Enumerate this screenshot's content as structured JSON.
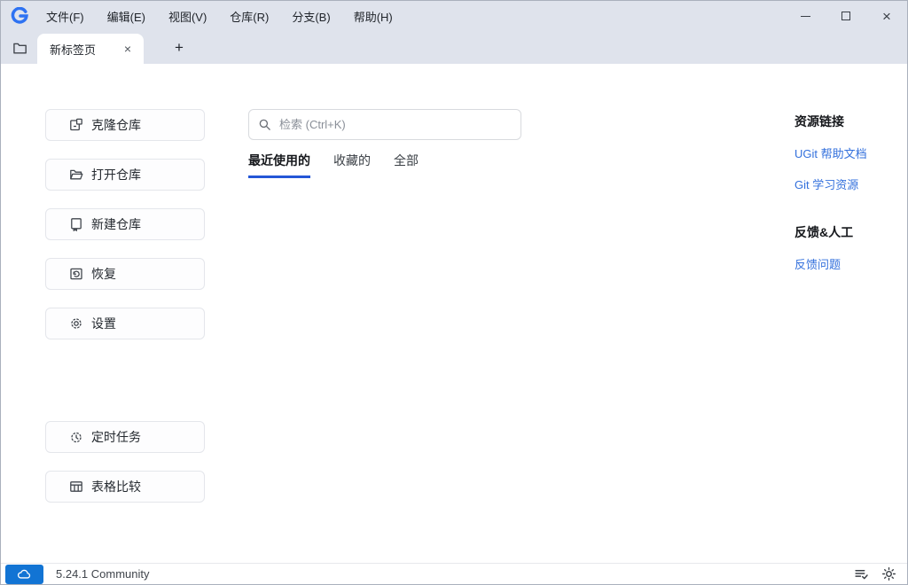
{
  "colors": {
    "accent": "#2456d6",
    "link": "#3370dc",
    "status_blue": "#1274d4",
    "chrome_bg": "#dfe3ec"
  },
  "titlebar": {
    "menu_items": [
      {
        "label": "文件(F)"
      },
      {
        "label": "编辑(E)"
      },
      {
        "label": "视图(V)"
      },
      {
        "label": "仓库(R)"
      },
      {
        "label": "分支(B)"
      },
      {
        "label": "帮助(H)"
      }
    ],
    "controls": {
      "close": "×"
    }
  },
  "tabbar": {
    "active_tab_label": "新标签页",
    "close_glyph": "×",
    "new_tab_glyph": "+"
  },
  "sidebar": {
    "buttons": [
      {
        "label": "克隆仓库",
        "icon": "clone-repo-icon"
      },
      {
        "label": "打开仓库",
        "icon": "open-repo-icon"
      },
      {
        "label": "新建仓库",
        "icon": "new-repo-icon"
      },
      {
        "label": "恢复",
        "icon": "restore-icon"
      },
      {
        "label": "设置",
        "icon": "gear-icon"
      },
      {
        "label": "定时任务",
        "icon": "scheduled-task-icon"
      },
      {
        "label": "表格比较",
        "icon": "table-compare-icon"
      }
    ]
  },
  "main": {
    "search": {
      "placeholder": "检索 (Ctrl+K)"
    },
    "filter_tabs": [
      {
        "label": "最近使用的",
        "active": true
      },
      {
        "label": "收藏的",
        "active": false
      },
      {
        "label": "全部",
        "active": false
      }
    ]
  },
  "links_panel": {
    "sections": [
      {
        "title": "资源链接",
        "links": [
          "UGit 帮助文档",
          "Git 学习资源"
        ]
      },
      {
        "title": "反馈&人工",
        "links": [
          "反馈问题"
        ]
      }
    ]
  },
  "statusbar": {
    "version": "5.24.1 Community"
  },
  "icons": {
    "app-logo-icon": "blue G arc",
    "minimize-icon": "horizontal line",
    "maximize-icon": "outlined square",
    "close-icon": "×",
    "folder-icon": "outline folder",
    "search-icon": "magnifier",
    "cloud-icon": "cloud outline",
    "activity-log-icon": "lines with checkmark",
    "theme-icon": "sun"
  }
}
